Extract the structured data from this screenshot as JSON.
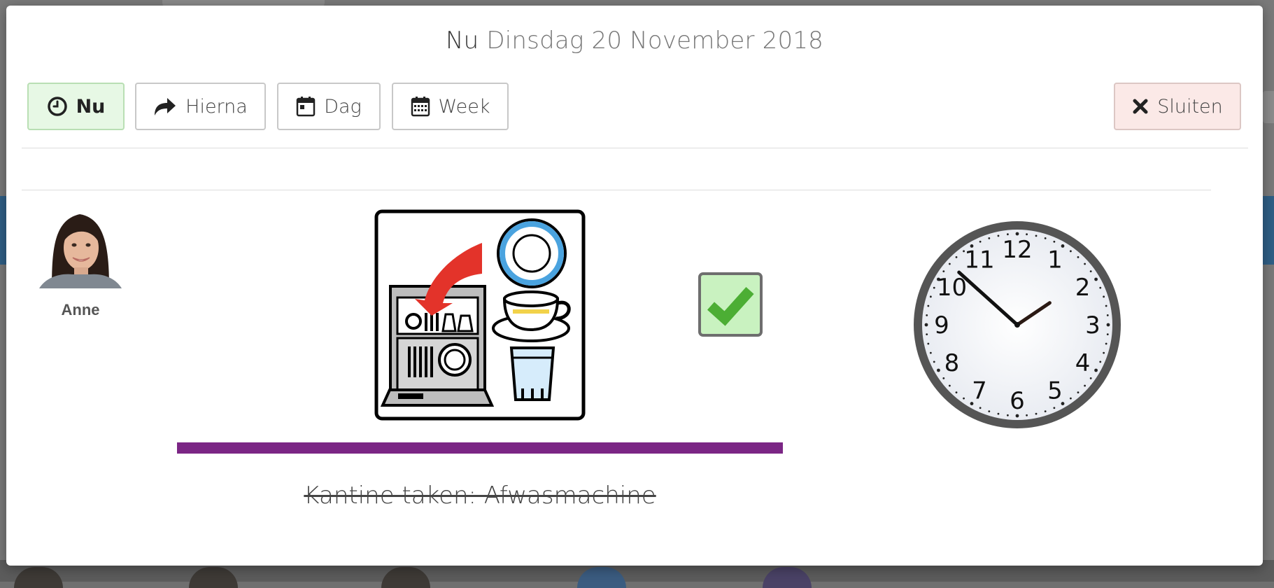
{
  "header": {
    "now_word": "Nu",
    "date": "Dinsdag 20 November 2018"
  },
  "toolbar": {
    "now_label": "Nu",
    "next_label": "Hierna",
    "day_label": "Dag",
    "week_label": "Week",
    "close_label": "Sluiten"
  },
  "user": {
    "name": "Anne"
  },
  "task": {
    "label": "Kantine taken: Afwasmachine",
    "completed": true,
    "pictogram": "dishwasher-icon",
    "bar_color": "#7b2685"
  },
  "clock": {
    "hour": 1,
    "minute": 52
  },
  "colors": {
    "now_button_bg": "#e7f8e5",
    "close_button_bg": "#fbe9e7",
    "check_green": "#4cae34",
    "check_bg": "#c9f2c0"
  }
}
